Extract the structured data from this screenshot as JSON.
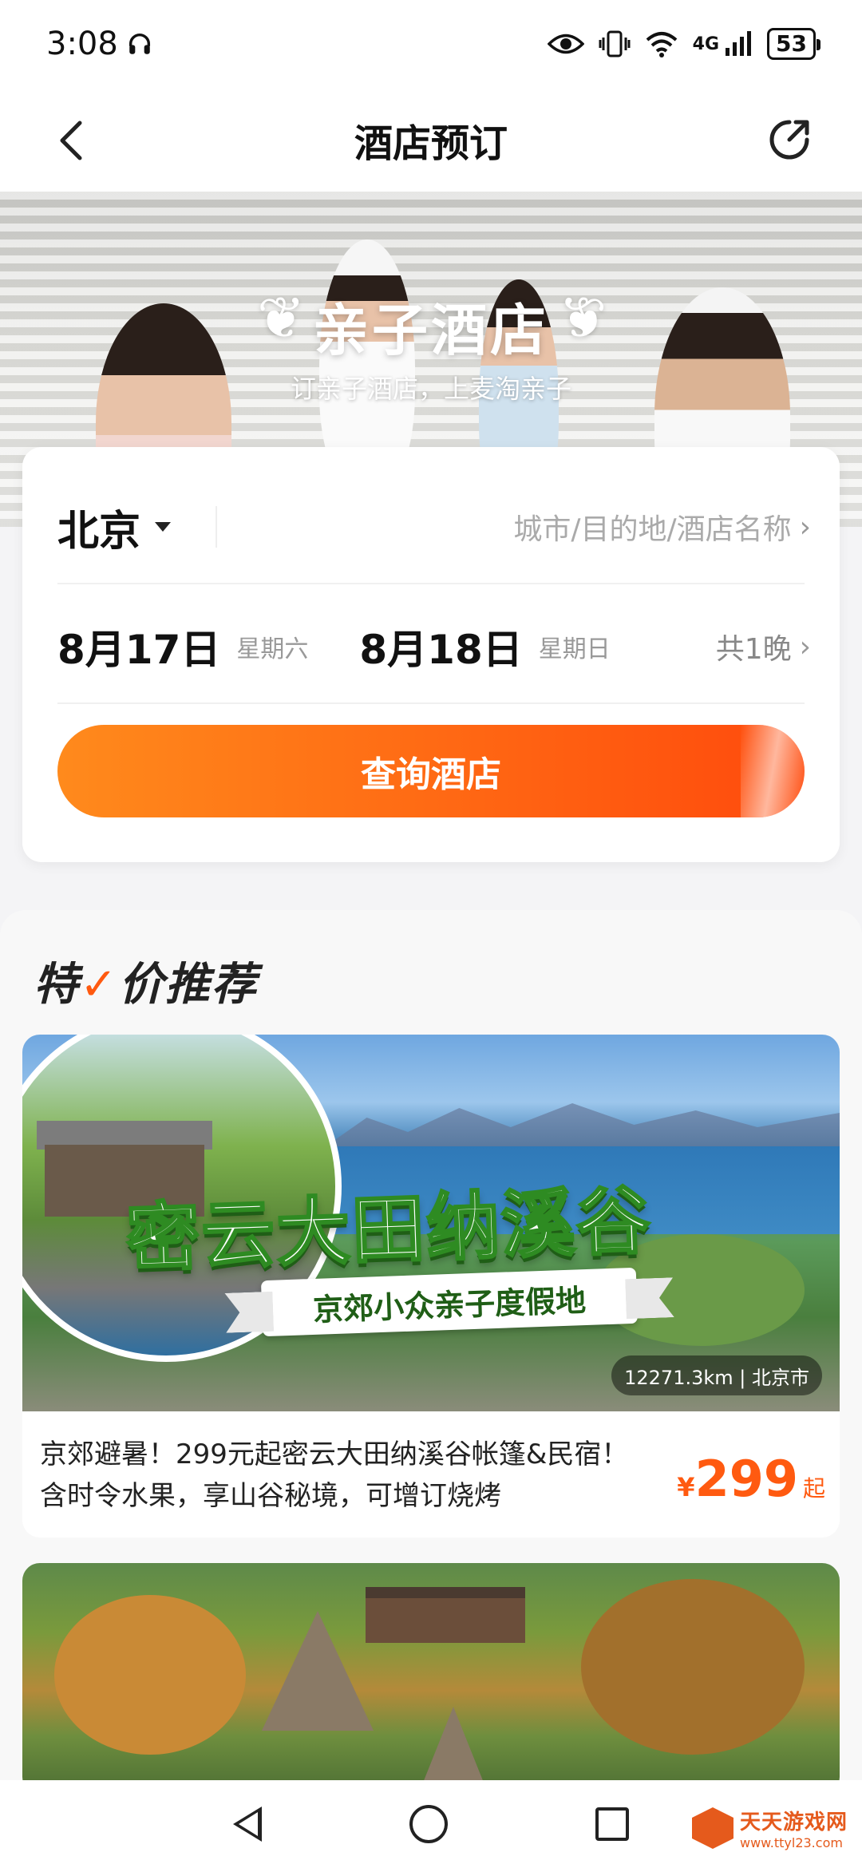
{
  "status_bar": {
    "time": "3:08",
    "headphone_icon": "headphone-icon",
    "battery": "53",
    "network": "4G"
  },
  "header": {
    "title": "酒店预订",
    "back_icon": "back-arrow-icon",
    "share_icon": "share-icon"
  },
  "banner": {
    "title": "亲子酒店",
    "subtitle": "订亲子酒店，上麦淘亲子"
  },
  "search": {
    "city": "北京",
    "destination_placeholder": "城市/目的地/酒店名称",
    "checkin_date": "8月17日",
    "checkin_weekday": "星期六",
    "checkout_date": "8月18日",
    "checkout_weekday": "星期日",
    "nights": "共1晚",
    "button_label": "查询酒店"
  },
  "recommend": {
    "title_left": "特",
    "title_right": "价推荐",
    "cards": [
      {
        "image_title": "密云大田纳溪谷",
        "image_ribbon": "京郊小众亲子度假地",
        "distance": "12271.3km | 北京市",
        "description": "京郊避暑！299元起密云大田纳溪谷帐篷&民宿！含时令水果，享山谷秘境，可增订烧烤",
        "price_currency": "¥",
        "price": "299",
        "price_suffix": "起"
      }
    ]
  },
  "nav_bar": {
    "back": "nav-back-icon",
    "home": "nav-home-icon",
    "recent": "nav-recent-icon"
  },
  "watermark": {
    "name": "天天游戏网",
    "url": "www.ttyl23.com"
  },
  "colors": {
    "accent": "#ff5a10",
    "button_start": "#ff8a1c",
    "button_end": "#ff4a0c"
  }
}
